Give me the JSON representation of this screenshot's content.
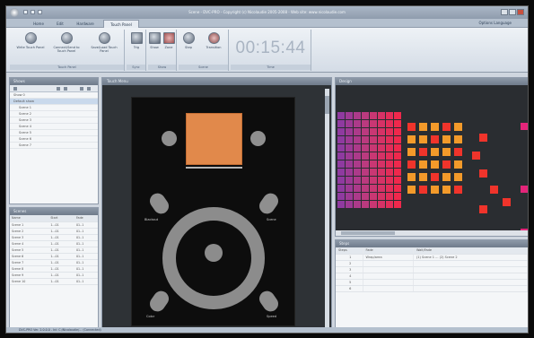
{
  "window": {
    "title": "Scene - DVC-PRO  -  Copyright (c) Nicolaudie 2005-2008  -  Web site: www.nicolaudie.com"
  },
  "ribbon": {
    "tabs": [
      "Home",
      "Edit",
      "Hardware",
      "Touch Panel"
    ],
    "active_tab": "Touch Panel",
    "help_label": "Options  Language",
    "groups": [
      {
        "label": "Touch Panel",
        "buttons": [
          "Write Touch Panel",
          "Connect/Send to Touch Panel",
          "Save/Load Touch Panel"
        ]
      },
      {
        "label": "Sync",
        "buttons": [
          "Trig"
        ]
      },
      {
        "label": "Show",
        "buttons": [
          "Show",
          "Zone"
        ]
      },
      {
        "label": "Scene",
        "buttons": [
          "Step",
          "Transition"
        ]
      },
      {
        "label": "Time",
        "buttons": []
      }
    ],
    "clock": "00:15:44"
  },
  "shows_panel": {
    "title": "Shows",
    "items": [
      "Show 0",
      "Default show",
      "Scene 1",
      "Scene 2",
      "Scene 3",
      "Scene 4",
      "Scene 5",
      "Scene 6",
      "Scene 7"
    ]
  },
  "scenes_panel": {
    "title": "Scenes",
    "headers": [
      "Name",
      "Start",
      "Fade"
    ],
    "rows": [
      [
        "Scene 1",
        "1...01",
        "01..1"
      ],
      [
        "Scene 2",
        "1...01",
        "01..1"
      ],
      [
        "Scene 3",
        "1...01",
        "01..1"
      ],
      [
        "Scene 4",
        "1...01",
        "01..1"
      ],
      [
        "Scene 5",
        "1...01",
        "01..1"
      ],
      [
        "Scene 6",
        "1...01",
        "01..1"
      ],
      [
        "Scene 7",
        "1...01",
        "01..1"
      ],
      [
        "Scene 8",
        "1...01",
        "01..1"
      ],
      [
        "Scene 9",
        "1...01",
        "01..1"
      ],
      [
        "Scene 10",
        "1...01",
        "01..1"
      ]
    ]
  },
  "touch_panel": {
    "title": "Touch Menu",
    "labels": {
      "top_left": "Blackout",
      "top_right": "Scene",
      "bottom_left": "Color",
      "bottom_right": "Speed"
    }
  },
  "designer": {
    "title": "Design",
    "colors": {
      "gradient_left": "#8f3aa0",
      "gradient_mid": "#c23a7a",
      "gradient_right": "#f0284c",
      "lamp_orange": "#f39a2a",
      "lamp_red": "#f0342b",
      "lamp_pink": "#e4257a"
    }
  },
  "steps_panel": {
    "title": "Steps",
    "headers": [
      "Steps",
      "Fade",
      "Wait/Fade"
    ],
    "rows": [
      [
        "1",
        "Wrap/area",
        "(1) Scene 1 ... (2) Scene 2"
      ],
      [
        "2",
        "",
        ""
      ],
      [
        "3",
        "",
        ""
      ],
      [
        "4",
        "",
        ""
      ],
      [
        "5",
        "",
        ""
      ],
      [
        "6",
        "",
        ""
      ]
    ]
  },
  "statusbar": {
    "text": "DVC-PRO Ver. 2.0.0.0 - Ini: C:/Nicolaudie/... (Connected)"
  }
}
